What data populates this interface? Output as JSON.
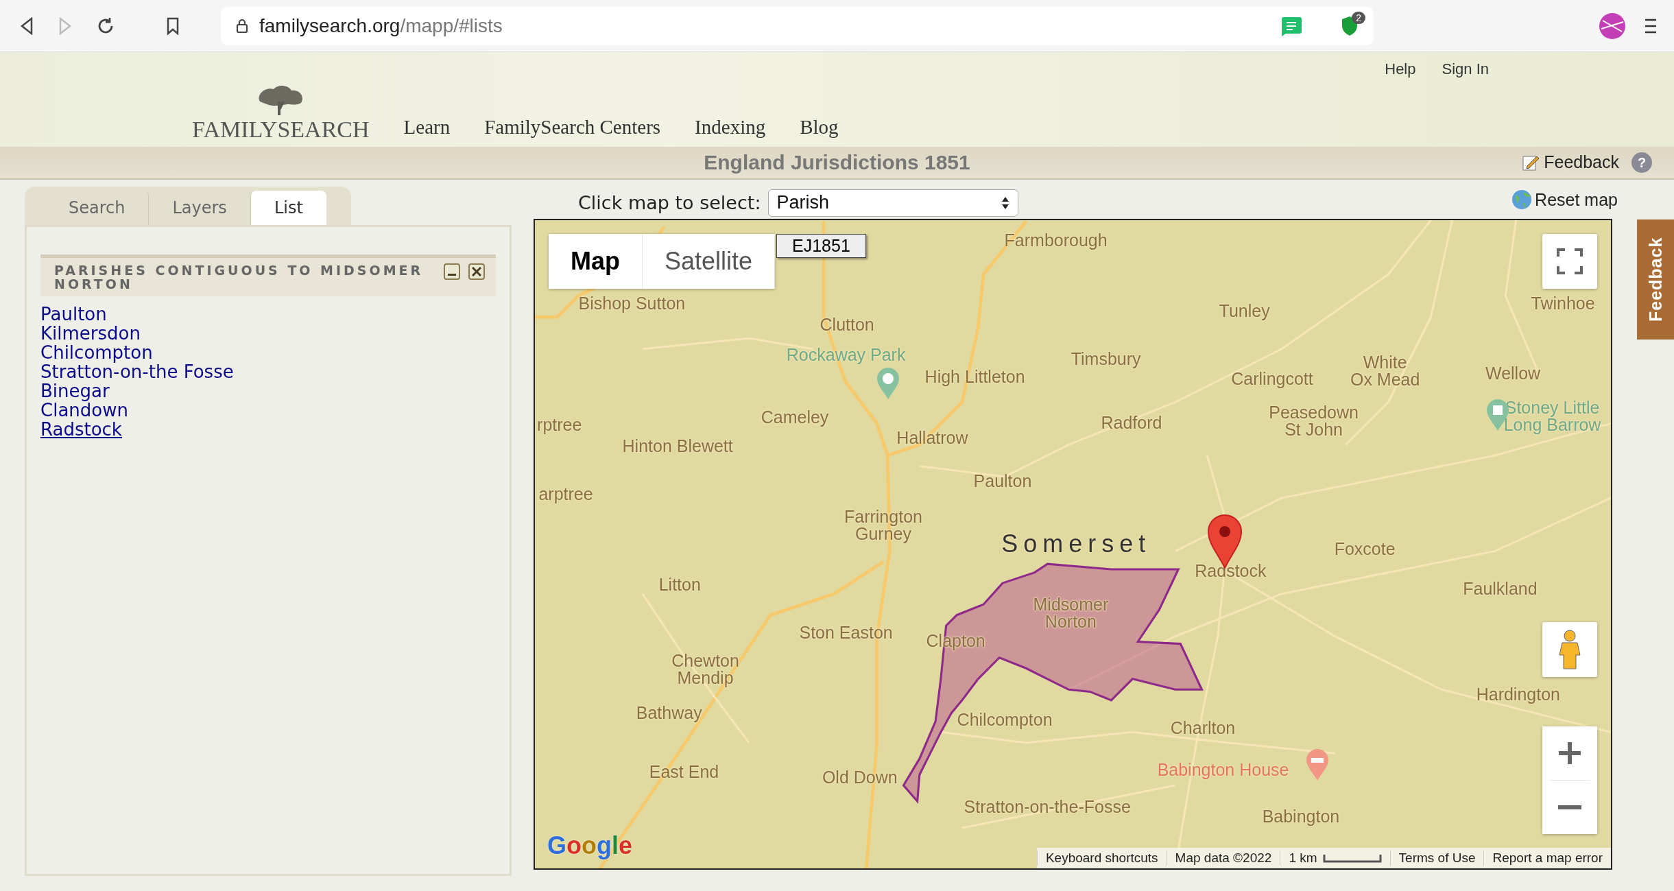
{
  "browser": {
    "url_host": "familysearch.org",
    "url_path": "/mapp/#lists",
    "forward_disabled": true,
    "extension_badge": "2"
  },
  "header": {
    "logo": "FAMILYSEARCH",
    "top_links": [
      "Help",
      "Sign In"
    ],
    "nav": [
      "Learn",
      "FamilySearch Centers",
      "Indexing",
      "Blog"
    ]
  },
  "title": "England Jurisdictions 1851",
  "feedback": "Feedback",
  "help": "?",
  "tabs": [
    {
      "label": "Search",
      "selected": false
    },
    {
      "label": "Layers",
      "selected": false
    },
    {
      "label": "List",
      "selected": true
    }
  ],
  "panel": {
    "title": "PARISHES CONTIGUOUS TO MIDSOMER NORTON",
    "items": [
      {
        "label": "Paulton",
        "hovered": false
      },
      {
        "label": "Kilmersdon",
        "hovered": false
      },
      {
        "label": "Chilcompton",
        "hovered": false
      },
      {
        "label": "Stratton-on-the Fosse",
        "hovered": false
      },
      {
        "label": "Binegar",
        "hovered": false
      },
      {
        "label": "Clandown",
        "hovered": false
      },
      {
        "label": "Radstock",
        "hovered": true
      }
    ]
  },
  "select": {
    "label": "Click map to select:",
    "value": "Parish"
  },
  "reset": "Reset map",
  "map": {
    "types": [
      {
        "label": "Map",
        "selected": true
      },
      {
        "label": "Satellite",
        "selected": false
      }
    ],
    "layer_tag": "EJ1851",
    "labels": [
      {
        "text": "Farmborough",
        "kind": "town"
      },
      {
        "text": "Bishop Sutton",
        "kind": "town"
      },
      {
        "text": "Clutton",
        "kind": "town"
      },
      {
        "text": "Rockaway Park",
        "kind": "park"
      },
      {
        "text": "High Littleton",
        "kind": "town"
      },
      {
        "text": "Timsbury",
        "kind": "town"
      },
      {
        "text": "Tunley",
        "kind": "town"
      },
      {
        "text": "Twinhoe",
        "kind": "town"
      },
      {
        "text": "Carlingcott",
        "kind": "town"
      },
      {
        "text": "White\nOx Mead",
        "kind": "town"
      },
      {
        "text": "Wellow",
        "kind": "town"
      },
      {
        "text": "rptree",
        "kind": "town"
      },
      {
        "text": "Cameley",
        "kind": "town"
      },
      {
        "text": "Hallatrow",
        "kind": "town"
      },
      {
        "text": "Radford",
        "kind": "town"
      },
      {
        "text": "Peasedown\nSt John",
        "kind": "town"
      },
      {
        "text": "Stoney Little\nLong Barrow",
        "kind": "park"
      },
      {
        "text": "Hinton Blewett",
        "kind": "town"
      },
      {
        "text": "arptree",
        "kind": "town"
      },
      {
        "text": "Paulton",
        "kind": "town"
      },
      {
        "text": "Farrington\nGurney",
        "kind": "town"
      },
      {
        "text": "Somerset",
        "kind": "region"
      },
      {
        "text": "Radstock",
        "kind": "town"
      },
      {
        "text": "Foxcote",
        "kind": "town"
      },
      {
        "text": "Faulkland",
        "kind": "town"
      },
      {
        "text": "Litton",
        "kind": "town"
      },
      {
        "text": "Midsomer\nNorton",
        "kind": "town"
      },
      {
        "text": "Clapton",
        "kind": "town"
      },
      {
        "text": "Ston Easton",
        "kind": "town"
      },
      {
        "text": "Chewton\nMendip",
        "kind": "town"
      },
      {
        "text": "Hardington",
        "kind": "town"
      },
      {
        "text": "Bathway",
        "kind": "town"
      },
      {
        "text": "Chilcompton",
        "kind": "town"
      },
      {
        "text": "Charlton",
        "kind": "town"
      },
      {
        "text": "East End",
        "kind": "town"
      },
      {
        "text": "Old Down",
        "kind": "town"
      },
      {
        "text": "Babington House",
        "kind": "hotel"
      },
      {
        "text": "Stratton-on-the-Fosse",
        "kind": "town"
      },
      {
        "text": "Babington",
        "kind": "town"
      }
    ],
    "logo": "Google",
    "footer": [
      "Keyboard shortcuts",
      "Map data ©2022"
    ],
    "scale": "1 km",
    "footer_links": [
      "Terms of Use",
      "Report a map error"
    ]
  },
  "side_tab": "Feedback"
}
